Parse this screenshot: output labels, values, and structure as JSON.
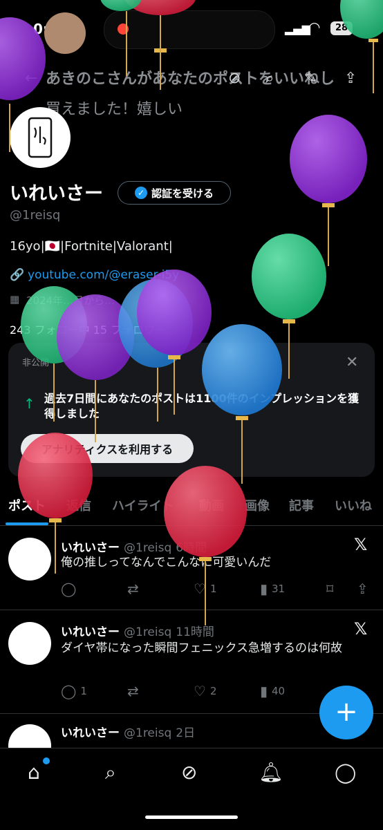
{
  "status": {
    "time": "0:00",
    "battery": "28"
  },
  "notification": {
    "line1": "あきのこさんがあなたのポストをいいねし",
    "line2": "買えました！嬉しい"
  },
  "profile": {
    "name": "いれいさー",
    "verify_button": "認証を受ける",
    "handle": "@1reisq",
    "bio": "16yo|🇯🇵|Fortnite|Valorant|",
    "link": "youtube.com/@eraser-i5y",
    "joined": "2024年…月から…",
    "follow": "243 フォロー中 15 フォロワー"
  },
  "analytics_card": {
    "tag": "非公開",
    "text": "過去7日間にあなたのポストは1100件のインプレッションを獲得しました",
    "button": "アナリティクスを利用する"
  },
  "tabs": [
    "ポスト",
    "返信",
    "ハイライト",
    "動画",
    "画像",
    "記事",
    "いいね"
  ],
  "posts": [
    {
      "name": "いれいさー",
      "handle": "@1reisq",
      "time": "6時間",
      "body": "俺の推しってなんでこんなに可愛いんだ",
      "replies": "",
      "reposts": "",
      "likes": "1",
      "views": "31"
    },
    {
      "name": "いれいさー",
      "handle": "@1reisq",
      "time": "11時間",
      "body": "ダイヤ帯になった瞬間フェニックス急増するのは何故",
      "replies": "1",
      "reposts": "",
      "likes": "2",
      "views": "40"
    },
    {
      "name": "いれいさー",
      "handle": "@1reisq",
      "time": "2日",
      "body": "",
      "replies": "",
      "reposts": "",
      "likes": "",
      "views": ""
    }
  ],
  "icons": {
    "back": "back-arrow-icon",
    "grok": "grok-icon",
    "search": "search-icon",
    "edit": "edit-icon",
    "share": "share-icon",
    "x_logo": "x-logo-icon",
    "fab": "compose-icon"
  },
  "colors": {
    "accent": "#1d9bf0",
    "green": "#00ba7c",
    "balloon_purple": "#8e2bd6",
    "balloon_green": "#2ecf8a",
    "balloon_blue": "#2f8ee6",
    "balloon_red": "#e8324d"
  }
}
